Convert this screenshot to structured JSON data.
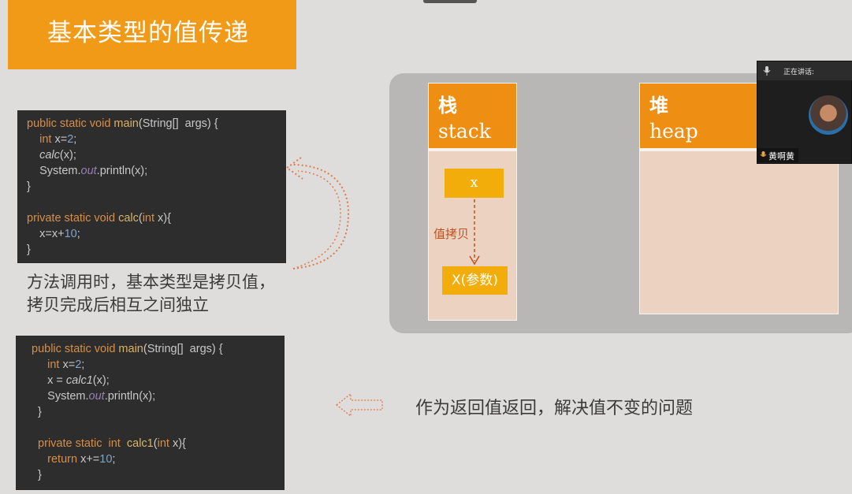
{
  "slide": {
    "title": "基本类型的值传递",
    "description_line1": "方法调用时，基本类型是拷贝值，",
    "description_line2": "拷贝完成后相互之间独立",
    "return_note": "作为返回值返回，解决值不变的问题",
    "colors": {
      "accent": "#f09a17",
      "header": "#ee8e12",
      "variable_box": "#f2ad0b",
      "code_bg": "#2d2d2d",
      "copy_arrow": "#c0501f"
    }
  },
  "code1": {
    "l1_kw": "public static void ",
    "l1_fn": "main",
    "l1_rest": "(String[]  args) {",
    "l2_kw": "    int ",
    "l2_a": "x=",
    "l2_num": "2",
    "l2_end": ";",
    "l3_it": "    calc",
    "l3_rest": "(x);",
    "l4_a": "    System.",
    "l4_it": "out",
    "l4_rest": ".println(x);",
    "l5": "}",
    "l7_kw": "private static void ",
    "l7_fn": "calc",
    "l7_a": "(",
    "l7_kw2": "int",
    "l7_rest": " x){",
    "l8_a": "    x=x+",
    "l8_num": "10",
    "l8_end": ";",
    "l9": "}"
  },
  "code2": {
    "l1_kw": "public static void ",
    "l1_fn": "main",
    "l1_rest": "(String[]  args) {",
    "l2_kw": "     int ",
    "l2_a": "x=",
    "l2_num": "2",
    "l2_end": ";",
    "l3_a": "     x = ",
    "l3_it": "calc1",
    "l3_rest": "(x);",
    "l4_a": "     System.",
    "l4_it": "out",
    "l4_rest": ".println(x);",
    "l5": "  }",
    "l7_kw": "  private static  int  ",
    "l7_fn": "calc1",
    "l7_a": "(",
    "l7_kw2": "int",
    "l7_rest": " x){",
    "l8_kw": "     return ",
    "l8_a": "x+=",
    "l8_num": "10",
    "l8_end": ";",
    "l9": "  }"
  },
  "memory": {
    "stack_cn": "栈",
    "stack_en": "stack",
    "heap_cn": "堆",
    "heap_en": "heap",
    "var_x": "x",
    "copy_label": "值拷贝",
    "var_param": "X(参数)"
  },
  "video": {
    "speaking_label": "正在讲话:",
    "speaker_name": "黄啊黄",
    "mic_icon": "microphone-icon"
  }
}
